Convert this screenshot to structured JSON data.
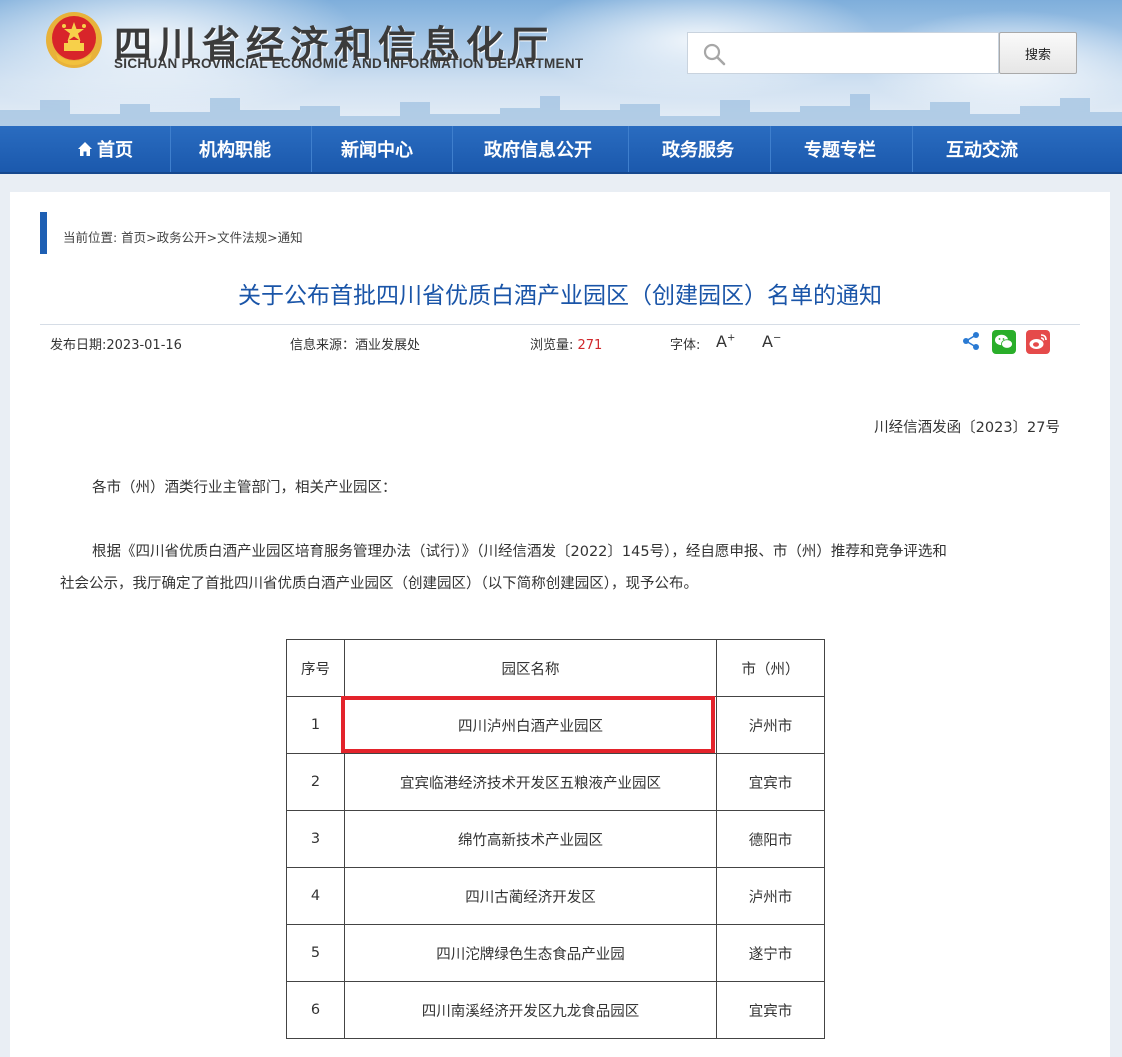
{
  "header": {
    "site_name_cn": "四川省经济和信息化厅",
    "site_name_en": "SICHUAN PROVINCIAL ECONOMIC AND INFORMATION DEPARTMENT",
    "search_placeholder": "",
    "search_button": "搜索"
  },
  "nav": {
    "items": [
      {
        "label": "首页",
        "icon": "home-icon"
      },
      {
        "label": "机构职能"
      },
      {
        "label": "新闻中心"
      },
      {
        "label": "政府信息公开"
      },
      {
        "label": "政务服务"
      },
      {
        "label": "专题专栏"
      },
      {
        "label": "互动交流"
      }
    ]
  },
  "breadcrumb": "当前位置: 首页>政务公开>文件法规>通知",
  "article": {
    "title": "关于公布首批四川省优质白酒产业园区（创建园区）名单的通知",
    "publish_date_label": "发布日期:",
    "publish_date": "2023-01-16",
    "source_label": "信息来源：",
    "source": "酒业发展处",
    "views_label": "浏览量: ",
    "views": "271",
    "font_label": "字体:",
    "font_increase": "A",
    "font_decrease": "A",
    "doc_number": "川经信酒发函〔2023〕27号",
    "salutation": "各市（州）酒类行业主管部门，相关产业园区：",
    "body_line1": "根据《四川省优质白酒产业园区培育服务管理办法（试行）》（川经信酒发〔2022〕145号），经自愿申报、市（州）推荐和竞争评选和",
    "body_line2": "社会公示，我厅确定了首批四川省优质白酒产业园区（创建园区）（以下简称创建园区），现予公布。"
  },
  "table": {
    "headers": [
      "序号",
      "园区名称",
      "市（州）"
    ],
    "rows": [
      [
        "1",
        "四川泸州白酒产业园区",
        "泸州市"
      ],
      [
        "2",
        "宜宾临港经济技术开发区五粮液产业园区",
        "宜宾市"
      ],
      [
        "3",
        "绵竹高新技术产业园区",
        "德阳市"
      ],
      [
        "4",
        "四川古蔺经济开发区",
        "泸州市"
      ],
      [
        "5",
        "四川沱牌绿色生态食品产业园",
        "遂宁市"
      ],
      [
        "6",
        "四川南溪经济开发区九龙食品园区",
        "宜宾市"
      ]
    ]
  },
  "colors": {
    "nav_bg": "#1b59ad",
    "title_blue": "#1a55a8",
    "highlight_red": "#e3232b",
    "views_red": "#d0272b"
  }
}
